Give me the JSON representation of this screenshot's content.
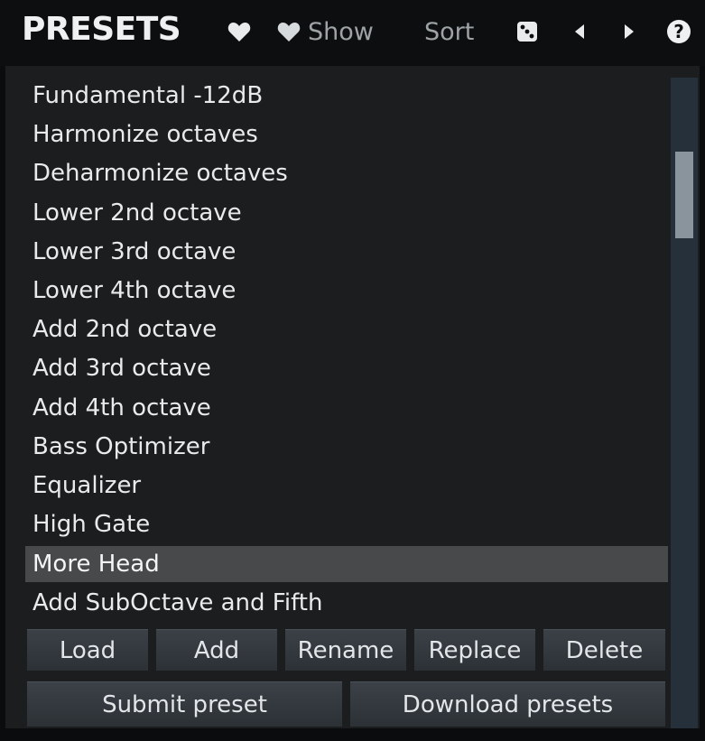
{
  "header": {
    "title": "PRESETS",
    "favorite_icon": "heart-icon",
    "show_label": "Show",
    "sort_label": "Sort",
    "random_icon": "dice-icon",
    "prev_icon": "triangle-left-icon",
    "next_icon": "triangle-right-icon",
    "help_label": "?"
  },
  "presets": {
    "items": [
      "Fundamental -12dB",
      "Harmonize octaves",
      "Deharmonize octaves",
      "Lower 2nd octave",
      "Lower 3rd octave",
      "Lower 4th octave",
      "Add 2nd octave",
      "Add 3rd octave",
      "Add 4th octave",
      "Bass Optimizer",
      "Equalizer",
      "High Gate",
      "More Head",
      "Add SubOctave and Fifth"
    ],
    "selected": "More Head"
  },
  "buttons": {
    "load": "Load",
    "add": "Add",
    "rename": "Rename",
    "replace": "Replace",
    "delete": "Delete",
    "submit": "Submit preset",
    "download": "Download presets"
  },
  "colors": {
    "background": "#1b1d1f",
    "header": "#0d0e0f",
    "selection": "#48494a",
    "scroll_track": "#26303a",
    "scroll_thumb": "#8a949c"
  }
}
